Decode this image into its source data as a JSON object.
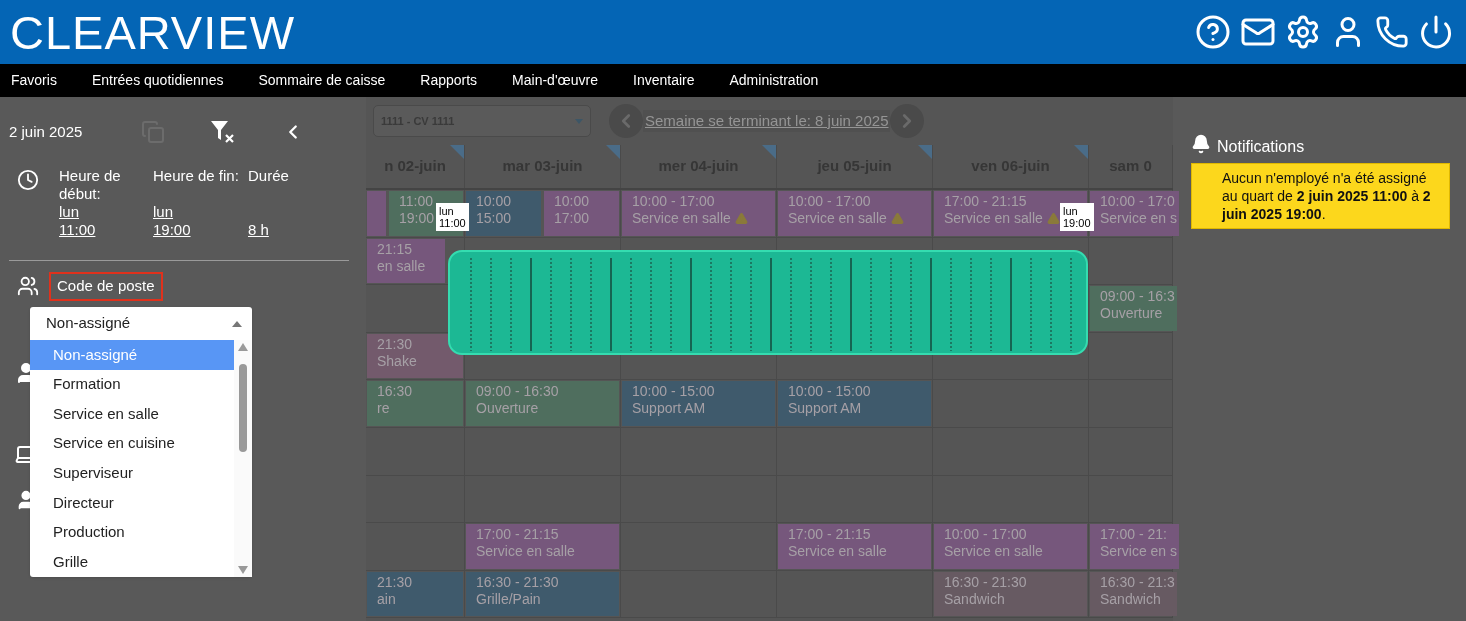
{
  "header": {
    "logo": "CLEARVIEW"
  },
  "menu": [
    "Favoris",
    "Entrées quotidiennes",
    "Sommaire de caisse",
    "Rapports",
    "Main-d'œuvre",
    "Inventaire",
    "Administration"
  ],
  "sidebar": {
    "date": "2 juin 2025",
    "time_fields": [
      {
        "label": "Heure de début:",
        "lines": [
          "lun",
          "11:00"
        ]
      },
      {
        "label": "Heure de fin:",
        "lines": [
          "lun",
          "19:00"
        ]
      },
      {
        "label": "Durée",
        "lines": [
          "8 h"
        ]
      }
    ],
    "position_label": "Code de poste",
    "dropdown": {
      "value": "Non-assigné",
      "expanded": true,
      "options": [
        {
          "label": "Non-assigné",
          "selected": true
        },
        {
          "label": "Formation",
          "selected": false
        },
        {
          "label": "Service en salle",
          "selected": false
        },
        {
          "label": "Service en cuisine",
          "selected": false
        },
        {
          "label": "Superviseur",
          "selected": false
        },
        {
          "label": "Directeur",
          "selected": false
        },
        {
          "label": "Production",
          "selected": false
        },
        {
          "label": "Grille",
          "selected": false
        }
      ]
    }
  },
  "schedule": {
    "location": "1111 - CV 1111",
    "week_link": "Semaine se terminant le: 8 juin 2025",
    "days": [
      "n 02-juin",
      "mar 03-juin",
      "mer 04-juin",
      "jeu 05-juin",
      "ven 06-juin",
      "sam 0"
    ],
    "rows": [
      [
        {
          "shifts": [
            {
              "color": "#76577c",
              "warning": false
            },
            {
              "lines": [
                "11:00",
                "19:00"
              ],
              "color": "#4f6e5e",
              "warning": false
            }
          ]
        },
        {
          "shifts": [
            {
              "lines": [
                "10:00",
                "15:00"
              ],
              "color": "#3f5a6c",
              "warning": false
            },
            {
              "lines": [
                "10:00",
                "17:00"
              ],
              "color": "#76577c",
              "warning": false
            }
          ]
        },
        {
          "shifts": [
            {
              "lines": [
                "10:00 - 17:00",
                "Service en salle"
              ],
              "color": "#76577c",
              "warning": true
            }
          ]
        },
        {
          "shifts": [
            {
              "lines": [
                "10:00 - 17:00",
                "Service en salle"
              ],
              "color": "#76577c",
              "warning": true
            }
          ]
        },
        {
          "shifts": [
            {
              "lines": [
                "17:00 - 21:15",
                "Service en salle"
              ],
              "color": "#76577c",
              "warning": true
            }
          ]
        },
        {
          "shifts": [
            {
              "lines": [
                "10:00 - 17:0",
                "Service en s"
              ],
              "color": "#76577c",
              "warning": false
            }
          ]
        }
      ],
      [
        {
          "shifts": [
            {
              "lines": [
                "21:15",
                "en salle"
              ],
              "color": "#76577c",
              "warning": false
            }
          ]
        },
        null,
        null,
        null,
        null,
        null
      ],
      [
        null,
        null,
        null,
        null,
        null,
        {
          "shifts": [
            {
              "lines": [
                "09:00 - 16:3",
                "Ouverture"
              ],
              "color": "#4f6e5e",
              "warning": false
            }
          ]
        }
      ],
      [
        {
          "shifts": [
            {
              "lines": [
                "21:30",
                "Shake"
              ],
              "color": "#735a6c",
              "warning": false
            }
          ]
        },
        null,
        null,
        null,
        null,
        null
      ],
      [
        {
          "shifts": [
            {
              "lines": [
                "16:30",
                "re"
              ],
              "color": "#4f6e5e",
              "warning": false
            }
          ]
        },
        {
          "shifts": [
            {
              "lines": [
                "09:00 - 16:30",
                "Ouverture"
              ],
              "color": "#4f6e5e",
              "warning": false
            }
          ]
        },
        {
          "shifts": [
            {
              "lines": [
                "10:00 - 15:00",
                "Support AM"
              ],
              "color": "#3f5a6c",
              "warning": false
            }
          ]
        },
        {
          "shifts": [
            {
              "lines": [
                "10:00 - 15:00",
                "Support AM"
              ],
              "color": "#3f5a6c",
              "warning": false
            }
          ]
        },
        null,
        null
      ],
      [
        null,
        null,
        null,
        null,
        null,
        null
      ],
      [
        null,
        null,
        null,
        null,
        null,
        null
      ],
      [
        null,
        {
          "shifts": [
            {
              "lines": [
                "17:00 - 21:15",
                "Service en salle"
              ],
              "color": "#76577c",
              "warning": false
            }
          ]
        },
        null,
        {
          "shifts": [
            {
              "lines": [
                "17:00 - 21:15",
                "Service en salle"
              ],
              "color": "#76577c",
              "warning": false
            }
          ]
        },
        {
          "shifts": [
            {
              "lines": [
                "10:00 - 17:00",
                "Service en salle"
              ],
              "color": "#76577c",
              "warning": false
            }
          ]
        },
        {
          "shifts": [
            {
              "lines": [
                "17:00 - 21:",
                "Service en s"
              ],
              "color": "#76577c",
              "warning": false
            }
          ]
        }
      ],
      [
        {
          "shifts": [
            {
              "lines": [
                "21:30",
                "ain"
              ],
              "color": "#3f5a6c",
              "warning": false
            }
          ]
        },
        {
          "shifts": [
            {
              "lines": [
                "16:30 - 21:30",
                "Grille/Pain"
              ],
              "color": "#3f5a6c",
              "warning": false
            }
          ]
        },
        null,
        null,
        {
          "shifts": [
            {
              "lines": [
                "16:30 - 21:30",
                "Sandwich"
              ],
              "color": "#675a62",
              "warning": false
            }
          ]
        },
        {
          "shifts": [
            {
              "lines": [
                "16:30 - 21:3",
                "Sandwich"
              ],
              "color": "#675a62",
              "warning": false
            }
          ]
        }
      ]
    ]
  },
  "selection": {
    "start": [
      "lun",
      "11:00"
    ],
    "end": [
      "lun",
      "19:00"
    ]
  },
  "notifications": {
    "title": "Notifications",
    "message": "Aucun n'employé n'a été assigné au quart de **2 juin 2025 11:00** à **2 juin 2025 19:00**."
  }
}
